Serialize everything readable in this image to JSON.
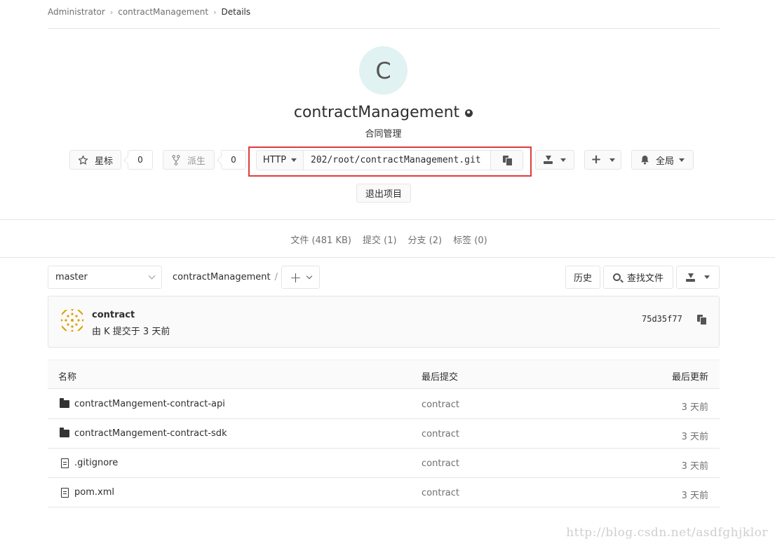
{
  "breadcrumb": {
    "items": [
      "Administrator",
      "contractManagement"
    ],
    "current": "Details"
  },
  "project": {
    "avatar_letter": "C",
    "name": "contractManagement",
    "description": "合同管理",
    "avatar_bg": "#e0f2f1"
  },
  "actions": {
    "star_label": "星标",
    "star_count": "0",
    "fork_label": "派生",
    "fork_count": "0",
    "clone_protocol": "HTTP",
    "clone_url": "202/root/contractManagement.git",
    "notification_label": "全局",
    "leave_label": "退出项目"
  },
  "nav": {
    "files": "文件 (481 KB)",
    "commits": "提交 (1)",
    "branches": "分支 (2)",
    "tags": "标签 (0)"
  },
  "toolbar": {
    "branch": "master",
    "path": "contractManagement",
    "path_sep": "/",
    "history_label": "历史",
    "find_file_label": "查找文件"
  },
  "commit": {
    "title": "contract",
    "meta": "由 K 提交于 3 天前",
    "sha": "75d35f77"
  },
  "table": {
    "headers": {
      "name": "名称",
      "last_commit": "最后提交",
      "last_update": "最后更新"
    },
    "rows": [
      {
        "name": "contractMangement-contract-api",
        "type": "folder",
        "commit": "contract",
        "date": "3 天前"
      },
      {
        "name": "contractMangement-contract-sdk",
        "type": "folder",
        "commit": "contract",
        "date": "3 天前"
      },
      {
        "name": ".gitignore",
        "type": "file",
        "commit": "contract",
        "date": "3 天前"
      },
      {
        "name": "pom.xml",
        "type": "file",
        "commit": "contract",
        "date": "3 天前"
      }
    ]
  },
  "watermark": "http://blog.csdn.net/asdfghjklor",
  "colors": {
    "highlight": "#e03b3b",
    "commit_avatar": "#d9a300"
  }
}
